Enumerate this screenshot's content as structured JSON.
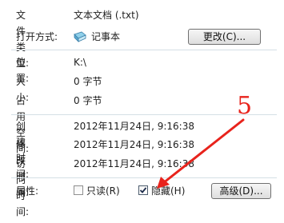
{
  "file_type": {
    "label": "文件类型:",
    "value": "文本文档 (.txt)"
  },
  "opens_with": {
    "label": "打开方式:",
    "app": "记事本",
    "icon": "notepad-icon",
    "change_button": "更改(C)..."
  },
  "location": {
    "label": "位置:",
    "value": "K:\\"
  },
  "size": {
    "label": "大小:",
    "value": "0 字节"
  },
  "size_on_disk": {
    "label": "占用空间:",
    "value": "0 字节"
  },
  "created": {
    "label": "创建时间:",
    "value": "2012年11月24日, 9:16:38"
  },
  "modified": {
    "label": "修改时间:",
    "value": "2012年11月24日, 9:16:38"
  },
  "accessed": {
    "label": "访问时间:",
    "value": "2012年11月24日, 9:16:38"
  },
  "attributes": {
    "label": "属性:",
    "readonly": {
      "label": "只读(R)",
      "checked": false
    },
    "hidden": {
      "label": "隐藏(H)",
      "checked": true
    },
    "advanced_button": "高级(D)..."
  },
  "annotation": {
    "number": "5",
    "color": "#e8231c"
  }
}
